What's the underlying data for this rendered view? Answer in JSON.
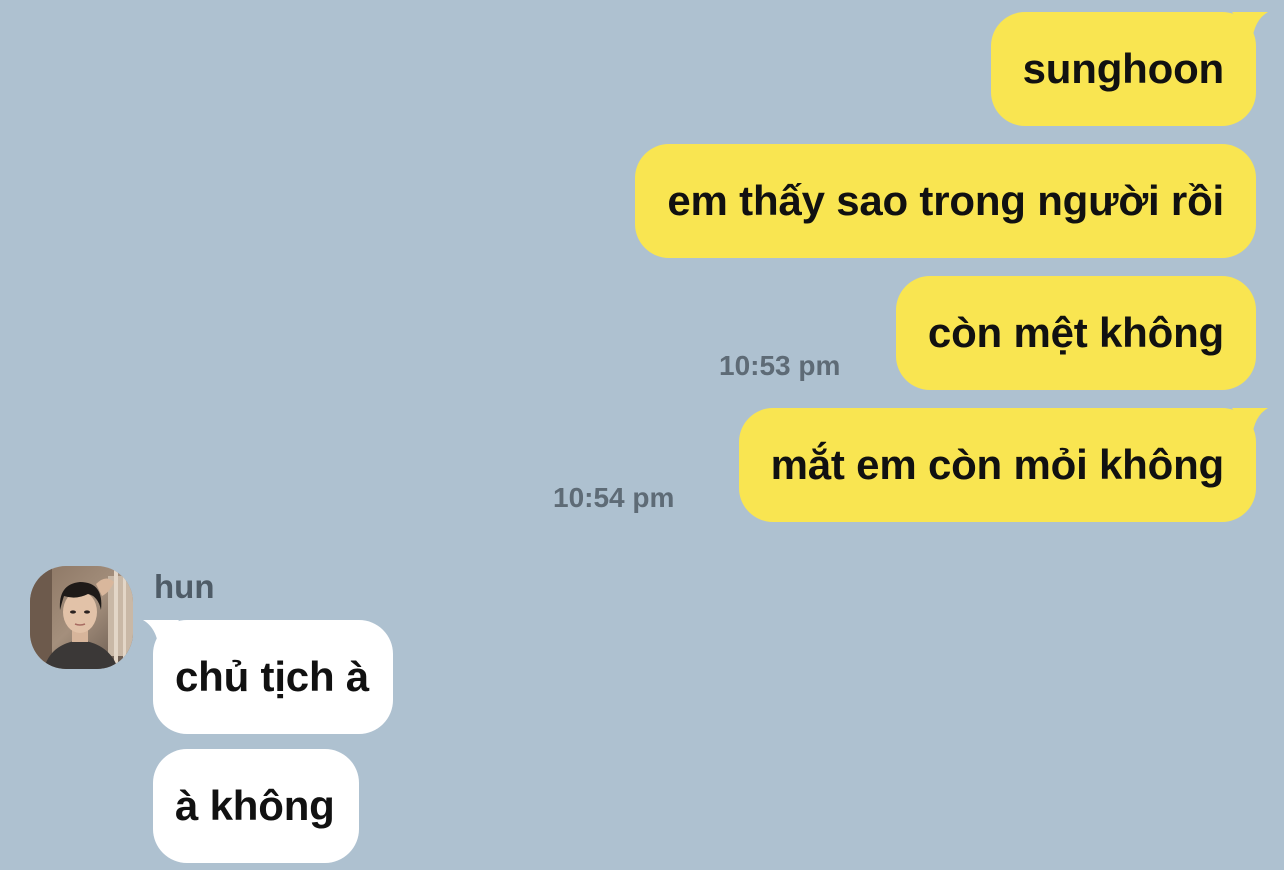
{
  "colors": {
    "background": "#aec1d0",
    "outgoing_bubble": "#f9e551",
    "incoming_bubble": "#ffffff",
    "timestamp": "#5e6b76"
  },
  "messages": [
    {
      "direction": "outgoing",
      "text": "sunghoon",
      "time": ""
    },
    {
      "direction": "outgoing",
      "text": "em thấy sao trong người rồi",
      "time": ""
    },
    {
      "direction": "outgoing",
      "text": "còn mệt không",
      "time": "10:53 pm"
    },
    {
      "direction": "outgoing",
      "text": "mắt em còn mỏi không",
      "time": "10:54 pm"
    }
  ],
  "contact": {
    "name": "hun",
    "avatar_icon": "profile-photo"
  },
  "incoming": [
    {
      "text": "chủ tịch à"
    },
    {
      "text": "à không"
    }
  ]
}
